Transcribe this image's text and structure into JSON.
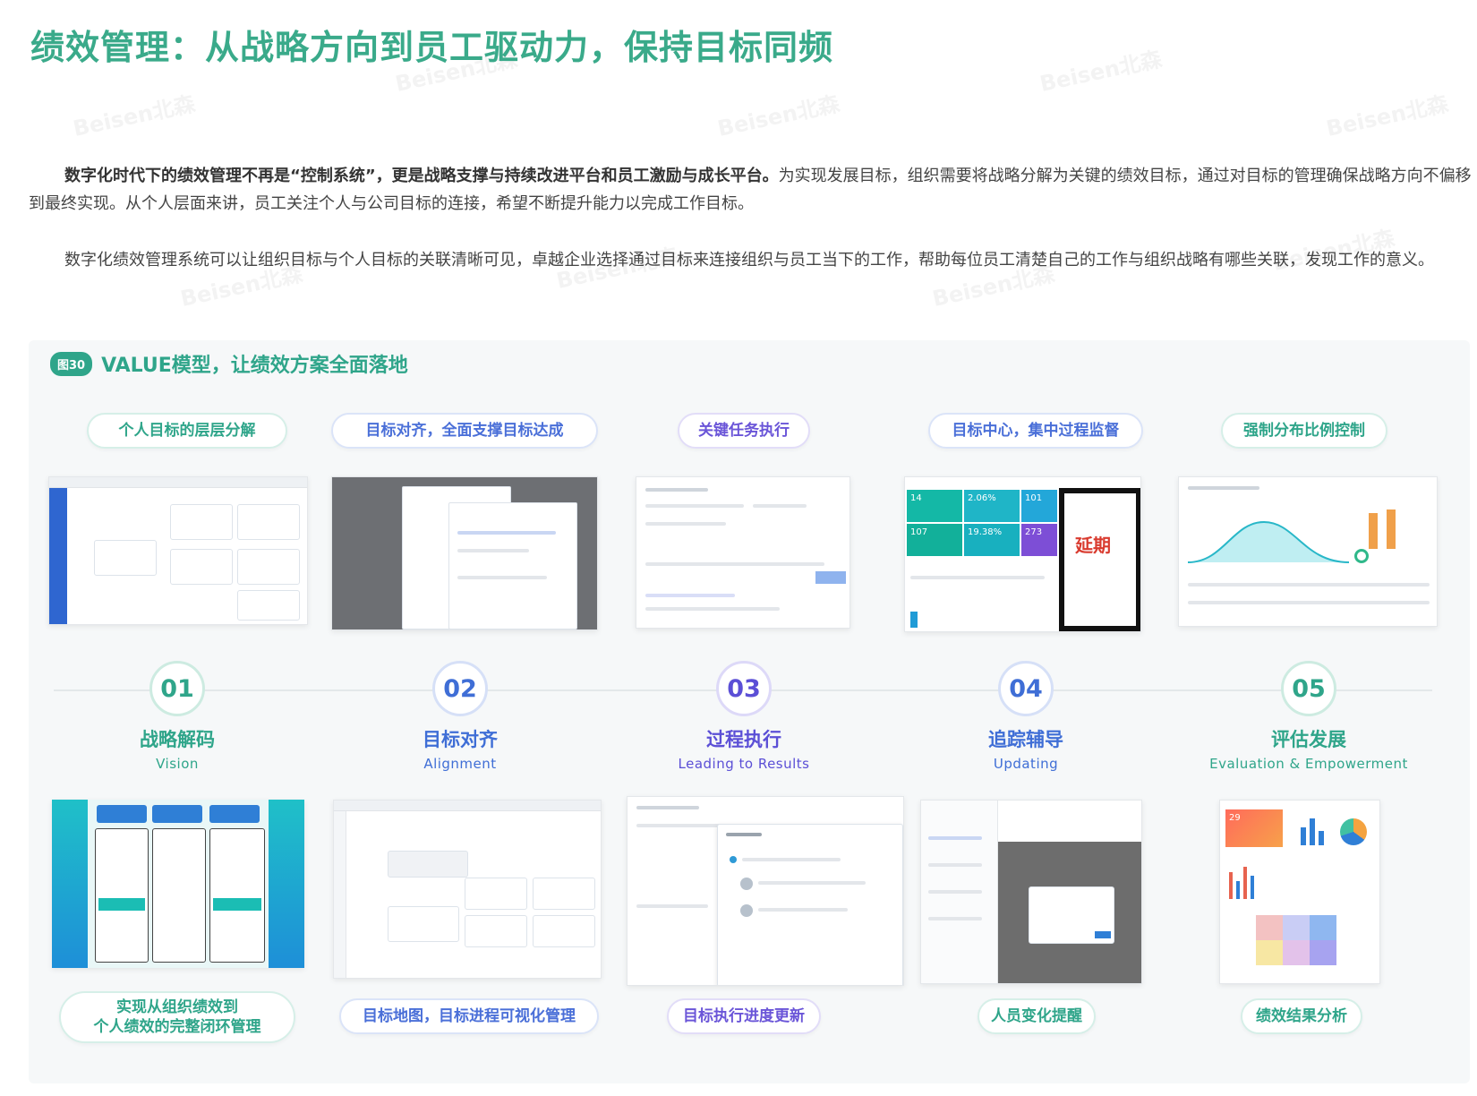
{
  "title": "绩效管理：从战略方向到员工驱动力，保持目标同频",
  "paragraphs": {
    "p1_bold": "数字化时代下的绩效管理不再是“控制系统”，更是战略支撑与持续改进平台和员工激励与成长平台。",
    "p1_rest": "为实现发展目标，组织需要将战略分解为关键的绩效目标，通过对目标的管理确保战略方向不偏移到最终实现。从个人层面来讲，员工关注个人与公司目标的连接，希望不断提升能力以完成工作目标。",
    "p2": "数字化绩效管理系统可以让组织目标与个人目标的关联清晰可见，卓越企业选择通过目标来连接组织与员工当下的工作，帮助每位员工清楚自己的工作与组织战略有哪些关联，发现工作的意义。"
  },
  "figure": {
    "badge": "图30",
    "title": "VALUE模型，让绩效方案全面落地"
  },
  "top_pills": [
    "个人目标的层层分解",
    "目标对齐，全面支撑目标达成",
    "关键任务执行",
    "目标中心，集中过程监督",
    "强制分布比例控制"
  ],
  "stages": [
    {
      "num": "01",
      "zh": "战略解码",
      "en": "Vision"
    },
    {
      "num": "02",
      "zh": "目标对齐",
      "en": "Alignment"
    },
    {
      "num": "03",
      "zh": "过程执行",
      "en": "Leading to Results"
    },
    {
      "num": "04",
      "zh": "追踪辅导",
      "en": "Updating"
    },
    {
      "num": "05",
      "zh": "评估发展",
      "en": "Evaluation & Empowerment"
    }
  ],
  "bottom_pills": [
    "实现从组织绩效到\n个人绩效的完整闭环管理",
    "目标地图，目标进程可视化管理",
    "目标执行进度更新",
    "人员变化提醒",
    "绩效结果分析"
  ],
  "screens": {
    "delay_label": "延期",
    "dashboard_numbers": [
      "14",
      "2.06%",
      "101",
      "107",
      "19.38%",
      "273"
    ],
    "chart_number": "29"
  },
  "watermark": "Beisen北森",
  "colors": {
    "green": "#2fa58a",
    "blue": "#3f6ed6",
    "purple": "#5b4fd6"
  }
}
